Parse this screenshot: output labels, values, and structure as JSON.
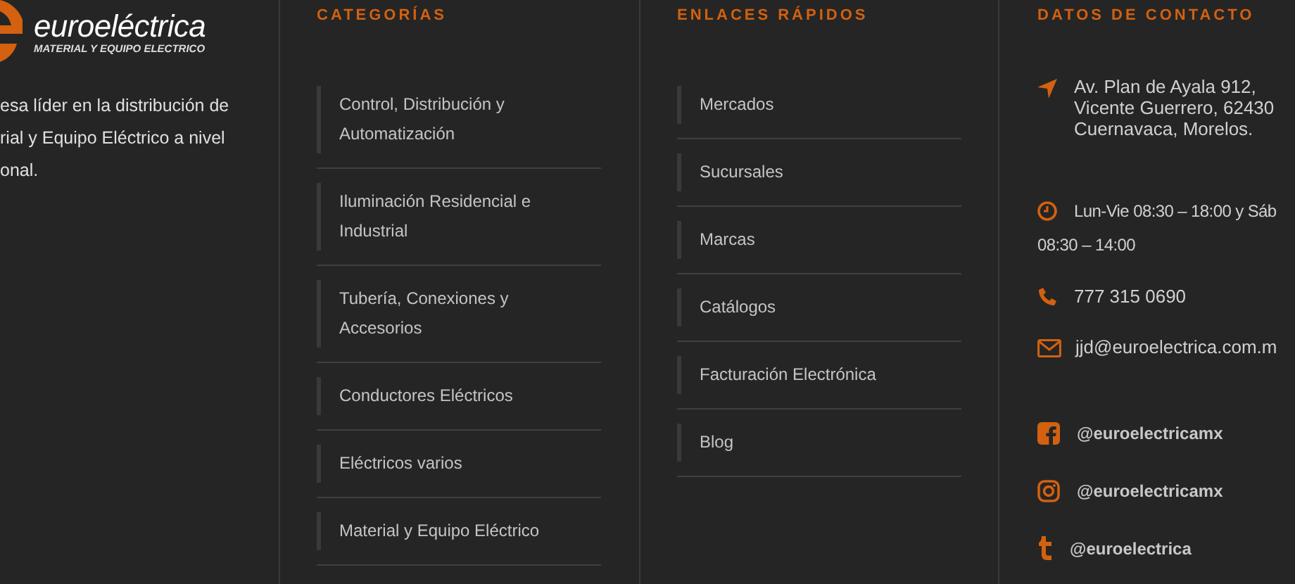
{
  "brand": {
    "name": "euroeléctrica",
    "tagline": "MATERIAL Y EQUIPO ELECTRICO",
    "about_lines": [
      "esa líder en la distribución de",
      "rial y Equipo Eléctrico a nivel",
      "onal."
    ]
  },
  "categories": {
    "heading": "CATEGORÍAS",
    "items": [
      {
        "label": "Control, Distribución y Automatización"
      },
      {
        "label": "Iluminación Residencial e Industrial"
      },
      {
        "label": "Tubería, Conexiones y Accesorios"
      },
      {
        "label": "Conductores Eléctricos"
      },
      {
        "label": "Eléctricos varios"
      },
      {
        "label": "Material y Equipo Eléctrico"
      }
    ]
  },
  "quick_links": {
    "heading": "ENLACES RÁPIDOS",
    "items": [
      {
        "label": "Mercados"
      },
      {
        "label": "Sucursales"
      },
      {
        "label": "Marcas"
      },
      {
        "label": "Catálogos"
      },
      {
        "label": "Facturación Electrónica"
      },
      {
        "label": "Blog"
      }
    ]
  },
  "contact": {
    "heading": "DATOS DE CONTACTO",
    "address_lines": [
      "Av. Plan de Ayala 912,",
      "Vicente Guerrero, 62430",
      "Cuernavaca, Morelos."
    ],
    "hours_lines": [
      "Lun-Vie 08:30 – 18:00 y Sáb",
      "08:30 – 14:00"
    ],
    "phone": "777 315 0690",
    "email": "jjd@euroelectrica.com.m",
    "social": [
      {
        "kind": "facebook",
        "handle": "@euroelectricamx"
      },
      {
        "kind": "instagram",
        "handle": "@euroelectricamx"
      },
      {
        "kind": "tumblr",
        "handle": "@euroelectrica"
      }
    ]
  }
}
